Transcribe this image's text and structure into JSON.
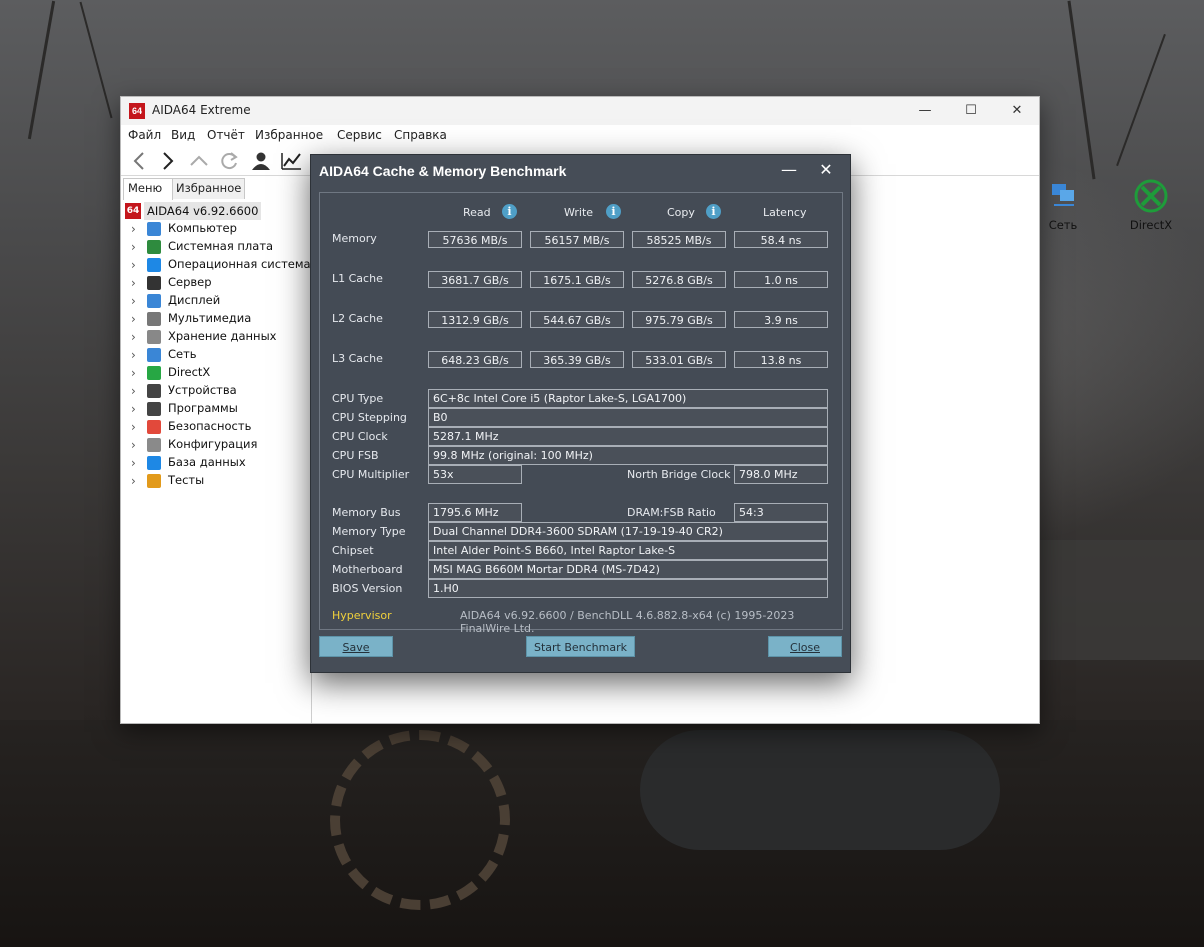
{
  "main_window": {
    "title": "AIDA64 Extreme",
    "app_icon_text": "64",
    "menu": [
      "Файл",
      "Вид",
      "Отчёт",
      "Избранное",
      "Сервис",
      "Справка"
    ],
    "tabs": [
      "Меню",
      "Избранное"
    ],
    "tree_root": "AIDA64 v6.92.6600",
    "tree_items": [
      {
        "label": "Компьютер",
        "icon": "computer-icon",
        "color": "#3a86d6"
      },
      {
        "label": "Системная плата",
        "icon": "motherboard-icon",
        "color": "#2e8b3e"
      },
      {
        "label": "Операционная система",
        "icon": "windows-icon",
        "color": "#1e88e5"
      },
      {
        "label": "Сервер",
        "icon": "server-icon",
        "color": "#333333"
      },
      {
        "label": "Дисплей",
        "icon": "display-icon",
        "color": "#3a86d6"
      },
      {
        "label": "Мультимедиа",
        "icon": "speaker-icon",
        "color": "#777777"
      },
      {
        "label": "Хранение данных",
        "icon": "storage-icon",
        "color": "#888888"
      },
      {
        "label": "Сеть",
        "icon": "network-icon",
        "color": "#3a86d6"
      },
      {
        "label": "DirectX",
        "icon": "xbox-icon",
        "color": "#27a744"
      },
      {
        "label": "Устройства",
        "icon": "devices-icon",
        "color": "#444444"
      },
      {
        "label": "Программы",
        "icon": "programs-icon",
        "color": "#444444"
      },
      {
        "label": "Безопасность",
        "icon": "security-shield-icon",
        "color": "#e2493b"
      },
      {
        "label": "Конфигурация",
        "icon": "configuration-icon",
        "color": "#8a8a8a"
      },
      {
        "label": "База данных",
        "icon": "database-icon",
        "color": "#1e88e5"
      },
      {
        "label": "Тесты",
        "icon": "tests-icon",
        "color": "#e29a1b"
      }
    ],
    "content_icons": [
      {
        "label": "Сеть",
        "icon": "network-icon"
      },
      {
        "label": "DirectX",
        "icon": "xbox-icon"
      }
    ]
  },
  "bench": {
    "title": "AIDA64 Cache & Memory Benchmark",
    "columns": {
      "read": "Read",
      "write": "Write",
      "copy": "Copy",
      "latency": "Latency"
    },
    "rows": [
      {
        "label": "Memory",
        "read": "57636 MB/s",
        "write": "56157 MB/s",
        "copy": "58525 MB/s",
        "latency": "58.4 ns"
      },
      {
        "label": "L1 Cache",
        "read": "3681.7 GB/s",
        "write": "1675.1 GB/s",
        "copy": "5276.8 GB/s",
        "latency": "1.0 ns"
      },
      {
        "label": "L2 Cache",
        "read": "1312.9 GB/s",
        "write": "544.67 GB/s",
        "copy": "975.79 GB/s",
        "latency": "3.9 ns"
      },
      {
        "label": "L3 Cache",
        "read": "648.23 GB/s",
        "write": "365.39 GB/s",
        "copy": "533.01 GB/s",
        "latency": "13.8 ns"
      }
    ],
    "cpu": {
      "type_label": "CPU Type",
      "type": "6C+8c Intel Core i5  (Raptor Lake-S, LGA1700)",
      "stepping_label": "CPU Stepping",
      "stepping": "B0",
      "clock_label": "CPU Clock",
      "clock": "5287.1 MHz",
      "fsb_label": "CPU FSB",
      "fsb": "99.8 MHz  (original: 100 MHz)",
      "multiplier_label": "CPU Multiplier",
      "multiplier": "53x",
      "nb_clock_label": "North Bridge Clock",
      "nb_clock": "798.0 MHz"
    },
    "memory": {
      "bus_label": "Memory Bus",
      "bus": "1795.6 MHz",
      "ratio_label": "DRAM:FSB Ratio",
      "ratio": "54:3",
      "type_label": "Memory Type",
      "type": "Dual Channel DDR4-3600 SDRAM  (17-19-19-40 CR2)",
      "chipset_label": "Chipset",
      "chipset": "Intel Alder Point-S B660, Intel Raptor Lake-S",
      "motherboard_label": "Motherboard",
      "motherboard": "MSI MAG B660M Mortar DDR4 (MS-7D42)",
      "bios_label": "BIOS Version",
      "bios": "1.H0"
    },
    "footer": {
      "hypervisor": "Hypervisor",
      "version": "AIDA64 v6.92.6600 / BenchDLL 4.6.882.8-x64  (c) 1995-2023 FinalWire Ltd."
    },
    "buttons": {
      "save": "Save",
      "start": "Start Benchmark",
      "close": "Close"
    },
    "colors": {
      "hypervisor": "#f0d13c",
      "button": "#7ab2c8",
      "panel": "#464d57"
    }
  }
}
